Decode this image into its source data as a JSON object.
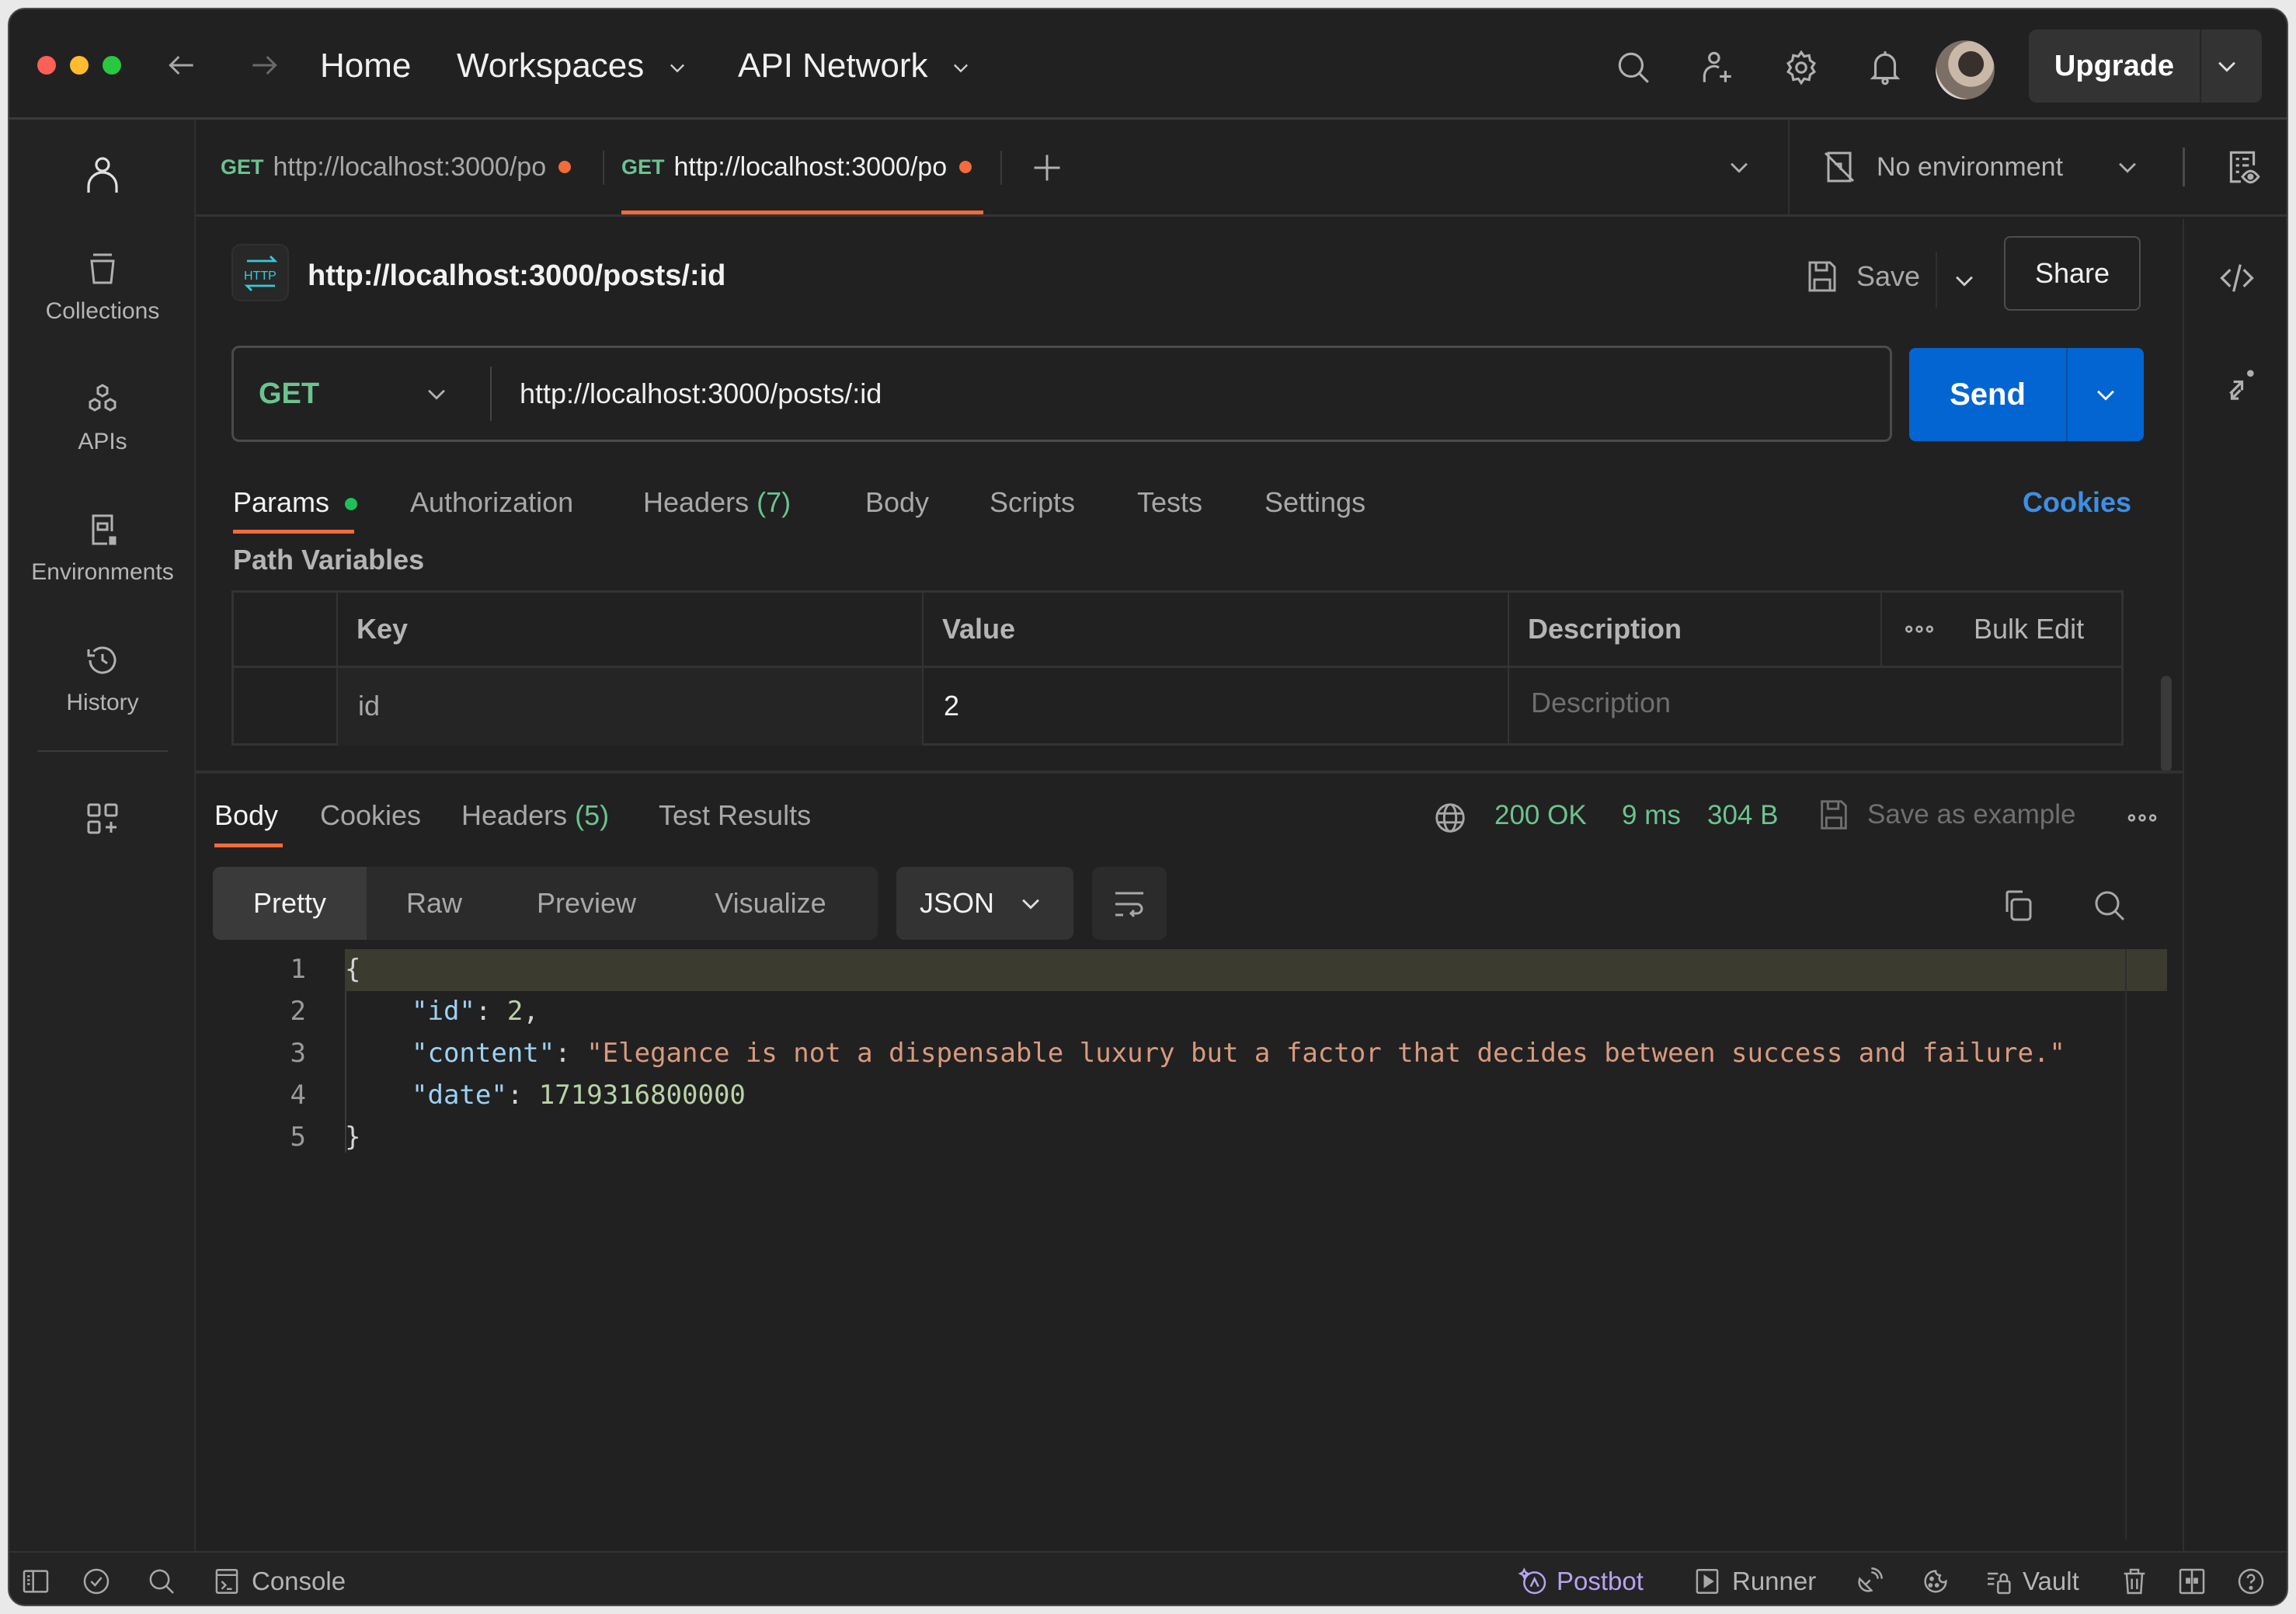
{
  "titlebar": {
    "nav_back": "back",
    "nav_forward": "forward",
    "home": "Home",
    "workspaces": "Workspaces",
    "api_network": "API Network",
    "upgrade": "Upgrade"
  },
  "sidebar": {
    "items": [
      {
        "label": "Collections",
        "icon": "trash-can-collection-icon"
      },
      {
        "label": "APIs",
        "icon": "hexagon-cluster-icon"
      },
      {
        "label": "Environments",
        "icon": "environment-icon"
      },
      {
        "label": "History",
        "icon": "history-icon"
      }
    ]
  },
  "tabs": [
    {
      "method": "GET",
      "title": "http://localhost:3000/po",
      "unsaved": true,
      "active": false
    },
    {
      "method": "GET",
      "title": "http://localhost:3000/po",
      "unsaved": true,
      "active": true
    }
  ],
  "environment": {
    "selected": "No environment"
  },
  "request": {
    "title": "http://localhost:3000/posts/:id",
    "save_label": "Save",
    "share_label": "Share",
    "method": "GET",
    "url": "http://localhost:3000/posts/:id",
    "send_label": "Send",
    "tabs": [
      {
        "label": "Params",
        "badge": "",
        "active": true,
        "dot": true
      },
      {
        "label": "Authorization",
        "badge": "",
        "active": false
      },
      {
        "label": "Headers",
        "badge": "(7)",
        "active": false
      },
      {
        "label": "Body",
        "badge": "",
        "active": false
      },
      {
        "label": "Scripts",
        "badge": "",
        "active": false
      },
      {
        "label": "Tests",
        "badge": "",
        "active": false
      },
      {
        "label": "Settings",
        "badge": "",
        "active": false
      }
    ],
    "cookies_link": "Cookies",
    "path_variables_title": "Path Variables",
    "table": {
      "headers": {
        "key": "Key",
        "value": "Value",
        "description": "Description",
        "bulk_edit": "Bulk Edit"
      },
      "rows": [
        {
          "key": "id",
          "value": "2",
          "description_placeholder": "Description"
        }
      ]
    }
  },
  "response": {
    "tabs": [
      {
        "label": "Body",
        "badge": "",
        "active": true
      },
      {
        "label": "Cookies",
        "badge": "",
        "active": false
      },
      {
        "label": "Headers",
        "badge": "(5)",
        "active": false
      },
      {
        "label": "Test Results",
        "badge": "",
        "active": false
      }
    ],
    "status": "200 OK",
    "time": "9 ms",
    "size": "304 B",
    "save_as_example": "Save as example",
    "view_modes": [
      "Pretty",
      "Raw",
      "Preview",
      "Visualize"
    ],
    "active_view": "Pretty",
    "format": "JSON",
    "body_lines": [
      {
        "no": "1"
      },
      {
        "no": "2",
        "key": "\"id\"",
        "value": "2",
        "type": "number",
        "trail": ","
      },
      {
        "no": "3",
        "key": "\"content\"",
        "value": "\"Elegance is not a dispensable luxury but a factor that decides between success and failure.\"",
        "type": "string",
        "trail": ","
      },
      {
        "no": "4",
        "key": "\"date\"",
        "value": "1719316800000",
        "type": "number",
        "trail": ""
      },
      {
        "no": "5"
      }
    ],
    "open_brace": "{",
    "close_brace": "}"
  },
  "statusbar": {
    "console": "Console",
    "postbot": "Postbot",
    "runner": "Runner",
    "vault": "Vault"
  },
  "colors": {
    "accent_orange": "#f26b3a",
    "send_blue": "#0265d2",
    "method_green": "#6cc38f",
    "cookies_blue": "#3d8fe6",
    "postbot_purple": "#b7a3f0"
  }
}
